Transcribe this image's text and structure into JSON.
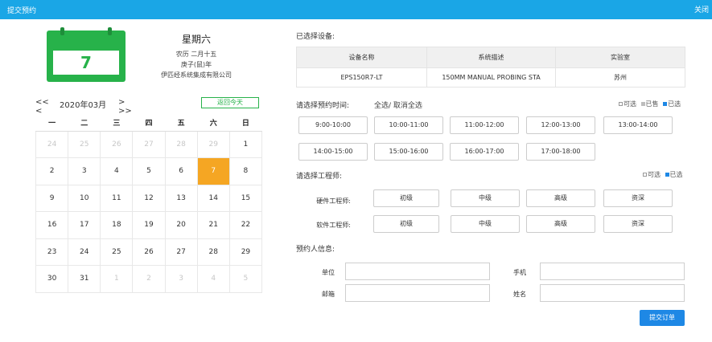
{
  "window": {
    "title": "提交预约",
    "close_label": "关闭"
  },
  "calendar": {
    "big_day": "7",
    "weekday": "星期六",
    "lunar": "农历 二月十五",
    "year_label": "庚子(鼠)年",
    "company": "伊匹经系统集成有限公司",
    "prev_label": "<< <",
    "month_label": "2020年03月",
    "next_label": "> >>",
    "today_label": "返回今天",
    "weekdays": [
      "一",
      "二",
      "三",
      "四",
      "五",
      "六",
      "日"
    ],
    "weeks": [
      [
        {
          "d": "24",
          "o": true
        },
        {
          "d": "25",
          "o": true
        },
        {
          "d": "26",
          "o": true
        },
        {
          "d": "27",
          "o": true
        },
        {
          "d": "28",
          "o": true
        },
        {
          "d": "29",
          "o": true
        },
        {
          "d": "1",
          "o": false
        }
      ],
      [
        {
          "d": "2",
          "o": false
        },
        {
          "d": "3",
          "o": false
        },
        {
          "d": "4",
          "o": false
        },
        {
          "d": "5",
          "o": false
        },
        {
          "d": "6",
          "o": false
        },
        {
          "d": "7",
          "o": false,
          "sel": true
        },
        {
          "d": "8",
          "o": false
        }
      ],
      [
        {
          "d": "9",
          "o": false
        },
        {
          "d": "10",
          "o": false
        },
        {
          "d": "11",
          "o": false
        },
        {
          "d": "12",
          "o": false
        },
        {
          "d": "13",
          "o": false
        },
        {
          "d": "14",
          "o": false
        },
        {
          "d": "15",
          "o": false
        }
      ],
      [
        {
          "d": "16",
          "o": false
        },
        {
          "d": "17",
          "o": false
        },
        {
          "d": "18",
          "o": false
        },
        {
          "d": "19",
          "o": false
        },
        {
          "d": "20",
          "o": false
        },
        {
          "d": "21",
          "o": false
        },
        {
          "d": "22",
          "o": false
        }
      ],
      [
        {
          "d": "23",
          "o": false
        },
        {
          "d": "24",
          "o": false
        },
        {
          "d": "25",
          "o": false
        },
        {
          "d": "26",
          "o": false
        },
        {
          "d": "27",
          "o": false
        },
        {
          "d": "28",
          "o": false
        },
        {
          "d": "29",
          "o": false
        }
      ],
      [
        {
          "d": "30",
          "o": false
        },
        {
          "d": "31",
          "o": false
        },
        {
          "d": "1",
          "o": true
        },
        {
          "d": "2",
          "o": true
        },
        {
          "d": "3",
          "o": true
        },
        {
          "d": "4",
          "o": true
        },
        {
          "d": "5",
          "o": true
        }
      ]
    ]
  },
  "device": {
    "section_label": "已选择设备:",
    "headers": [
      "设备名称",
      "系统描述",
      "实验室"
    ],
    "row": [
      "EPS150R7-LT",
      "150MM MANUAL PROBING STA",
      "苏州"
    ]
  },
  "time": {
    "section_label": "请选择预约时间:",
    "select_all": "全选/ 取消全选",
    "legend": {
      "available": "可选",
      "sold": "已售",
      "selected": "已选"
    },
    "slots": [
      "9:00-10:00",
      "10:00-11:00",
      "11:00-12:00",
      "12:00-13:00",
      "13:00-14:00",
      "14:00-15:00",
      "15:00-16:00",
      "16:00-17:00",
      "17:00-18:00"
    ]
  },
  "engineer": {
    "section_label": "请选择工程师:",
    "legend": {
      "available": "可选",
      "selected": "已选"
    },
    "hardware_label": "硬件工程师:",
    "software_label": "软件工程师:",
    "levels": [
      "初级",
      "中级",
      "高级",
      "资深"
    ]
  },
  "booker": {
    "section_label": "预约人信息:",
    "unit_label": "单位",
    "phone_label": "手机",
    "email_label": "邮箱",
    "name_label": "姓名",
    "unit_value": "",
    "phone_value": "",
    "email_value": "",
    "name_value": ""
  },
  "submit_label": "提交订单",
  "colors": {
    "titlebar": "#1aa6e6",
    "calendar_green": "#27b24a",
    "selected_day": "#f5a623",
    "submit": "#1e88e5",
    "legend_available": "#ffffff",
    "legend_sold": "#bdbdbd",
    "legend_selected": "#1e88e5"
  }
}
